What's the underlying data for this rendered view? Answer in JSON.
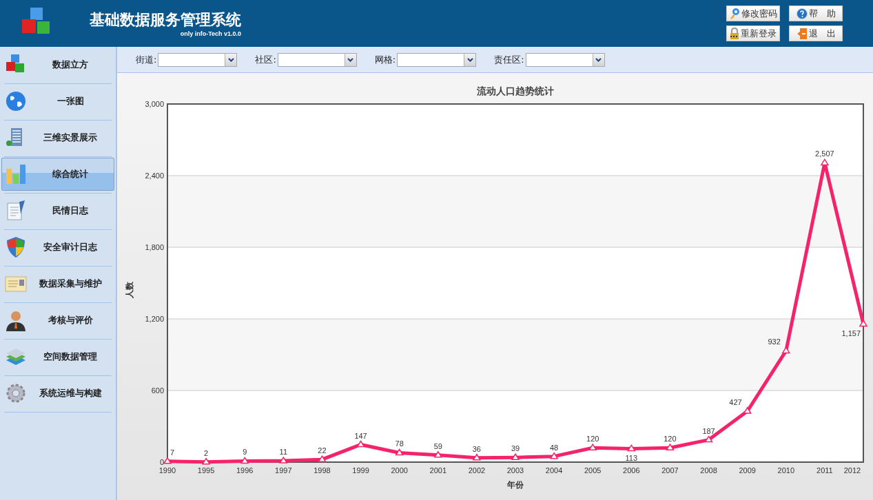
{
  "header": {
    "title": "基础数据服务管理系统",
    "version": "only info-Tech v1.0.0",
    "buttons": [
      {
        "label": "修改密码",
        "kind": "key"
      },
      {
        "label": "帮　助",
        "kind": "help"
      },
      {
        "label": "重新登录",
        "kind": "lock"
      },
      {
        "label": "退　出",
        "kind": "exit"
      }
    ]
  },
  "sidebar": {
    "items": [
      {
        "label": "数据立方",
        "selected": false
      },
      {
        "label": "一张图",
        "selected": false
      },
      {
        "label": "三维实景展示",
        "selected": false
      },
      {
        "label": "综合统计",
        "selected": true
      },
      {
        "label": "民情日志",
        "selected": false
      },
      {
        "label": "安全审计日志",
        "selected": false
      },
      {
        "label": "数据采集与维护",
        "selected": false
      },
      {
        "label": "考核与评价",
        "selected": false
      },
      {
        "label": "空间数据管理",
        "selected": false
      },
      {
        "label": "系统运维与构建",
        "selected": false
      }
    ]
  },
  "filters": [
    {
      "label": "街道:"
    },
    {
      "label": "社区:"
    },
    {
      "label": "网格:"
    },
    {
      "label": "责任区:"
    }
  ],
  "chart_data": {
    "type": "line",
    "title": "流动人口趋势统计",
    "xlabel": "年份",
    "ylabel": "人数",
    "categories": [
      "1990",
      "1995",
      "1996",
      "1997",
      "1998",
      "1999",
      "2000",
      "2001",
      "2002",
      "2003",
      "2004",
      "2005",
      "2006",
      "2007",
      "2008",
      "2009",
      "2010",
      "2011",
      "2012"
    ],
    "series": [
      {
        "color": "#f5236a",
        "marker": "triangle",
        "values": [
          7,
          2,
          9,
          11,
          22,
          147,
          78,
          59,
          36,
          39,
          48,
          120,
          113,
          120,
          187,
          427,
          932,
          2507,
          1157
        ]
      }
    ],
    "grid": true,
    "ylim": [
      0,
      3000
    ],
    "yticks": [
      {
        "value": 0,
        "label": "0"
      },
      {
        "value": 600,
        "label": "600"
      },
      {
        "value": 1200,
        "label": "1,200"
      },
      {
        "value": 1800,
        "label": "1,800"
      },
      {
        "value": 2400,
        "label": "2,400"
      },
      {
        "value": 3000,
        "label": "3,000"
      }
    ],
    "value_labels": [
      "7",
      "2",
      "9",
      "11",
      "22",
      "147",
      "78",
      "59",
      "36",
      "39",
      "48",
      "120",
      "113",
      "120",
      "187",
      "427",
      "932",
      "2,507",
      "1,157"
    ]
  }
}
